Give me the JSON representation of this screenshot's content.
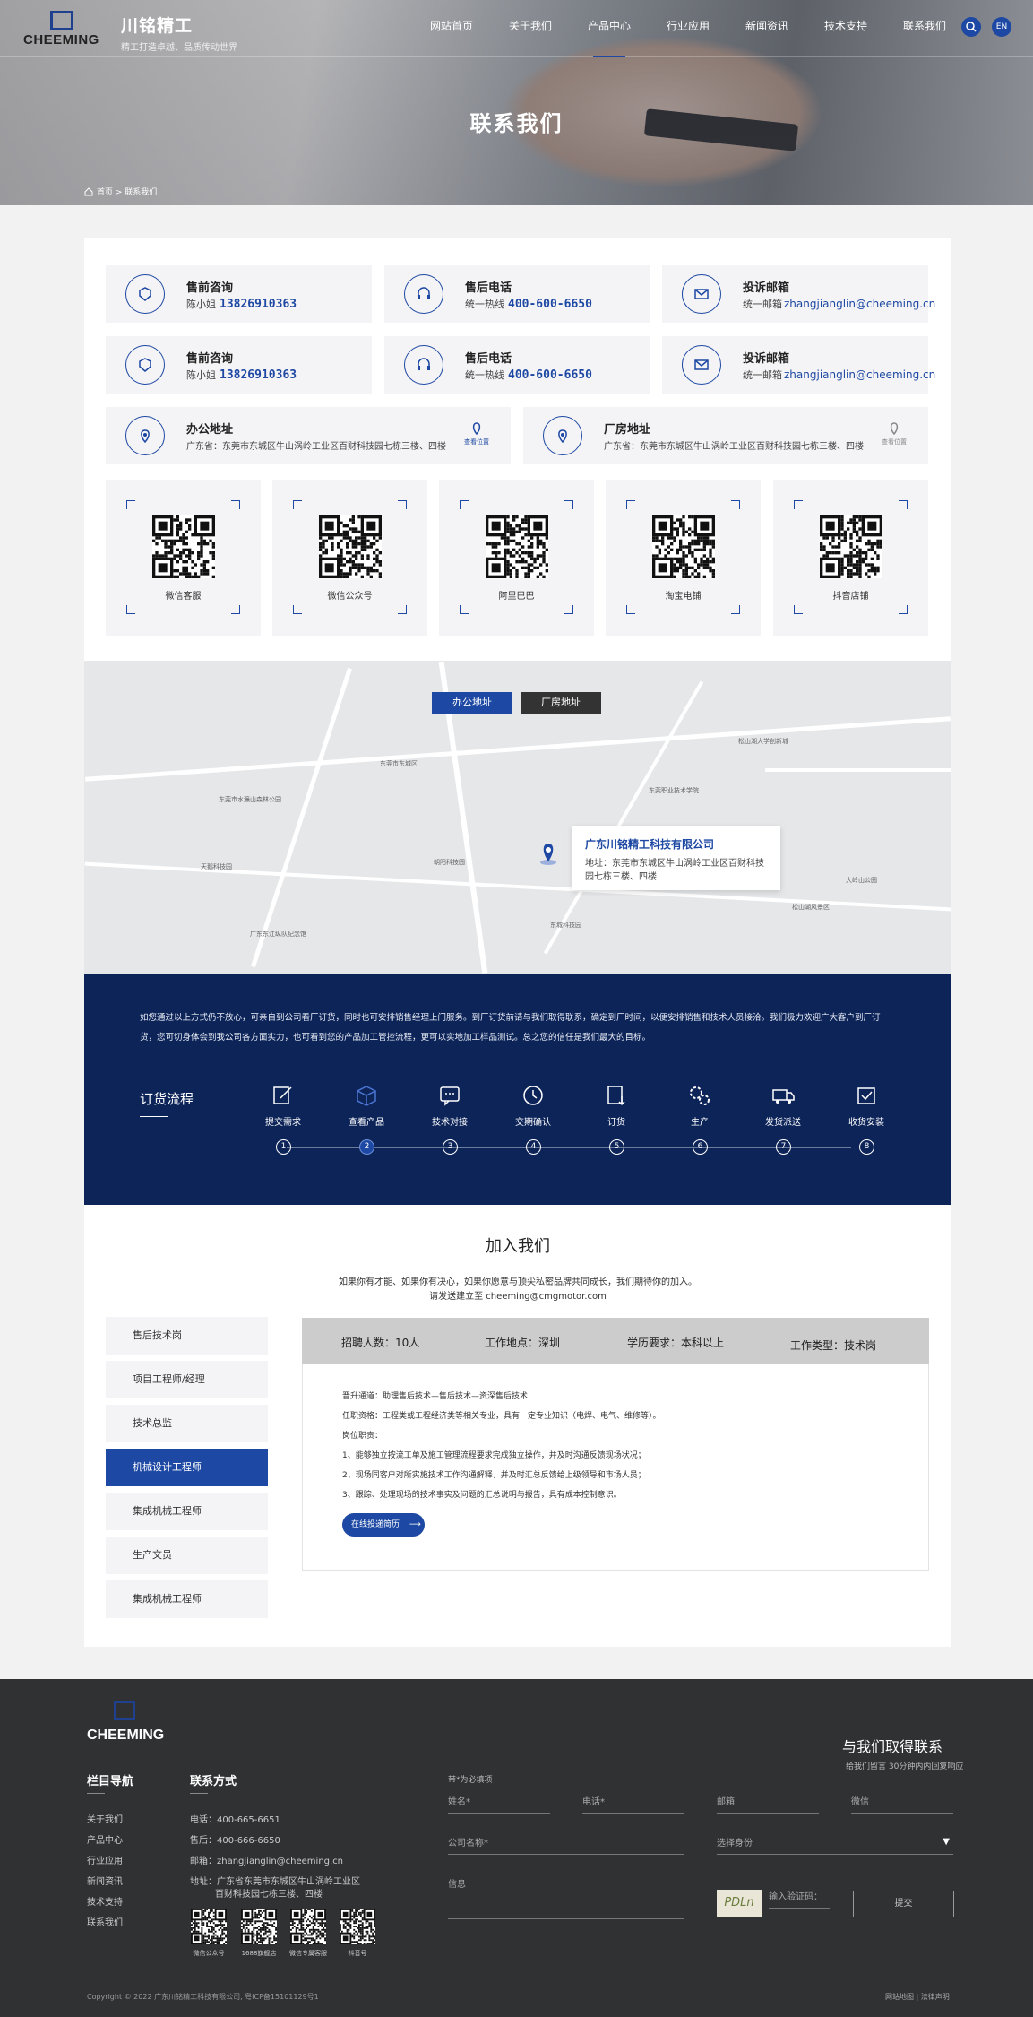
{
  "header": {
    "logo_text": "CHEEMING",
    "brand_name": "川铭精工",
    "brand_slogan": "精工打造卓越、品质传动世界",
    "nav": [
      "网站首页",
      "关于我们",
      "产品中心",
      "行业应用",
      "新闻资讯",
      "技术支持",
      "联系我们"
    ],
    "active_nav": "产品中心",
    "lang": "EN"
  },
  "hero": {
    "title": "联系我们",
    "breadcrumb": "首页 > 联系我们"
  },
  "contacts": [
    {
      "title": "售前咨询",
      "prefix": "陈小姐",
      "value": "13826910363",
      "icon": "presales-icon"
    },
    {
      "title": "售后电话",
      "prefix": "统一热线",
      "value": "400-600-6650",
      "icon": "headset-icon"
    },
    {
      "title": "投诉邮箱",
      "prefix": "统一邮箱",
      "value": "zhangjianglin@cheeming.cn",
      "icon": "mail-icon"
    },
    {
      "title": "售前咨询",
      "prefix": "陈小姐",
      "value": "13826910363",
      "icon": "presales-icon"
    },
    {
      "title": "售后电话",
      "prefix": "统一热线",
      "value": "400-600-6650",
      "icon": "headset-icon"
    },
    {
      "title": "投诉邮箱",
      "prefix": "统一邮箱",
      "value": "zhangjianglin@cheeming.cn",
      "icon": "mail-icon"
    }
  ],
  "addresses": [
    {
      "title": "办公地址",
      "value": "广东省：东莞市东城区牛山涡岭工业区百财科技园七栋三楼、四楼",
      "link": "查看位置"
    },
    {
      "title": "厂房地址",
      "value": "广东省：东莞市东城区牛山涡岭工业区百财科技园七栋三楼、四楼",
      "link": "查看位置"
    }
  ],
  "qrcodes": [
    "微信客服",
    "微信公众号",
    "阿里巴巴",
    "淘宝电铺",
    "抖音店铺"
  ],
  "map": {
    "tabs": [
      "办公地址",
      "厂房地址"
    ],
    "active_tab": "办公地址",
    "company": "广东川铭精工科技有限公司",
    "address_label": "地址：",
    "address_value": "东莞市东城区牛山涡岭工业区百财科技园七栋三楼、四楼",
    "labels": [
      "东莞市东城区",
      "东莞职业技术学院",
      "广东东江纵队纪念馆",
      "大岭山公园",
      "松山湖大学创新城",
      "东城科技园",
      "朝阳科技园",
      "松山湖风景区",
      "东莞市水濂山森林公园",
      "天鹅科技园"
    ]
  },
  "order": {
    "intro": "如您通过以上方式仍不放心，可亲自到公司看厂订货，同时也可安排销售经理上门服务。到厂订货前请与我们取得联系，确定到厂时间，以便安排销售和技术人员接洽。我们极力欢迎广大客户到厂订货，您可切身体会到我公司各方面实力，也可看到您的产品加工管控流程，更可以实地加工样品测试。总之您的信任是我们最大的目标。",
    "title": "订货流程",
    "steps": [
      {
        "label": "提交需求",
        "num": "1",
        "icon": "edit-icon"
      },
      {
        "label": "查看产品",
        "num": "2",
        "icon": "box-icon"
      },
      {
        "label": "技术对接",
        "num": "3",
        "icon": "chat-icon"
      },
      {
        "label": "交期确认",
        "num": "4",
        "icon": "clock-icon"
      },
      {
        "label": "订货",
        "num": "5",
        "icon": "order-icon"
      },
      {
        "label": "生产",
        "num": "6",
        "icon": "gears-icon"
      },
      {
        "label": "发货派送",
        "num": "7",
        "icon": "truck-icon"
      },
      {
        "label": "收货安装",
        "num": "8",
        "icon": "check-icon"
      }
    ],
    "active_step": "2"
  },
  "join": {
    "title": "加入我们",
    "desc1": "如果你有才能、如果你有决心，如果你愿意与顶尖私密品牌共同成长，我们期待你的加入。",
    "desc2": "请发送建立至 cheeming@cmgmotor.com",
    "jobs": [
      "售后技术岗",
      "项目工程师/经理",
      "技术总监",
      "机械设计工程师",
      "集成机械工程师",
      "生产文员",
      "集成机械工程师"
    ],
    "active_job": "机械设计工程师",
    "head": {
      "count": "招聘人数：10人",
      "place": "工作地点：深圳",
      "edu": "学历要求：本科以上",
      "type": "工作类型：技术岗"
    },
    "body": [
      "晋升通道：助理售后技术—售后技术—资深售后技术",
      "任职资格：工程类或工程经济类等相关专业，具有一定专业知识（电焊、电气、维修等）。",
      "岗位职责：",
      "1、能够独立按流工单及施工管理流程要求完成独立操作，并及时沟通反馈现场状况；",
      "2、现场同客户对所实施技术工作沟通解释，并及时汇总反馈给上级领导和市场人员；",
      "3、跟踪、处理现场的技术事实及问题的汇总说明与报告，具有成本控制意识。"
    ],
    "apply": "在线投递简历"
  },
  "footer": {
    "logo_text": "CHEEMING",
    "nav_title": "栏目导航",
    "nav": [
      "关于我们",
      "产品中心",
      "行业应用",
      "新闻资讯",
      "技术支持",
      "联系我们"
    ],
    "contact_title": "联系方式",
    "contact": [
      "电话：400-665-6651",
      "售后：400-666-6650",
      "邮箱：zhangjianglin@cheeming.cn",
      "地址：广东省东莞市东城区牛山涡岭工业区",
      "百财科技园七栋三楼、四楼"
    ],
    "qrs": [
      "微信公众号",
      "1688旗舰店",
      "微信专属客服",
      "抖音号"
    ],
    "form_title": "与我们取得联系",
    "form_sub": "给我们留言 30分钟内内回复响应",
    "required_note": "带*为必填项",
    "fields": [
      "姓名*",
      "电话*",
      "邮箱",
      "微信",
      "公司名称*",
      "选择身份",
      "信息",
      "输入验证码："
    ],
    "captcha": "PDLn",
    "submit": "提交",
    "copyright": "Copyright © 2022 广东川铭精工科技有限公司, 粤ICP备15101129号1",
    "links": "网站地图 | 法律声明"
  },
  "colors": {
    "primary": "#1d48a3",
    "dark_band": "#0d2459",
    "footer": "#303133"
  }
}
